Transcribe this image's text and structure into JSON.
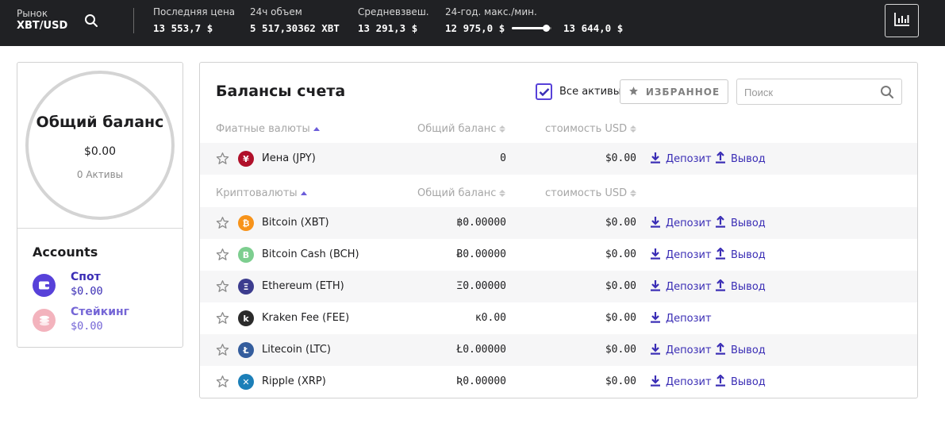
{
  "topbar": {
    "market_label": "Рынок",
    "market_pair": "XBT/USD",
    "last_price_label": "Последняя цена",
    "last_price_value": "13 553,7 $",
    "volume_label": "24ч объем",
    "volume_value": "5 517,30362 XBT",
    "vwap_label": "Средневзвеш.",
    "vwap_value": "13 291,3 $",
    "range_label": "24-год. макс./мин.",
    "range_low": "12 975,0 $",
    "range_high": "13 644,0 $",
    "range_position": 0.86
  },
  "summary": {
    "title": "Общий баланс",
    "amount": "$0.00",
    "assets_count": "0",
    "assets_label": "Активы"
  },
  "accounts": {
    "title": "Accounts",
    "items": [
      {
        "name": "Спот",
        "value": "$0.00",
        "color": "#5741d9",
        "icon": "wallet-icon"
      },
      {
        "name": "Стейкинг",
        "value": "$0.00",
        "color": "#8d7fe0",
        "icon": "coins-icon"
      }
    ]
  },
  "balances": {
    "title": "Балансы счета",
    "all_assets_label": "Все активы",
    "all_assets_checked": true,
    "favorites_label": "ИЗБРАННОЕ",
    "search_placeholder": "Поиск",
    "fiat_header": "Фиатные валюты",
    "crypto_header": "Криптовалюты",
    "balance_header": "Общий баланс",
    "usd_header": "стоимость USD",
    "deposit_label": "Депозит",
    "withdraw_label": "Вывод",
    "fiat_rows": [
      {
        "name": "Иена (JPY)",
        "symbol": "¥",
        "color": "#b0102a",
        "balance": "0",
        "usd": "$0.00",
        "withdraw": true
      }
    ],
    "crypto_rows": [
      {
        "name": "Bitcoin (XBT)",
        "symbol": "₿",
        "color": "#f7931a",
        "balance": "฿0.00000",
        "usd": "$0.00",
        "withdraw": true
      },
      {
        "name": "Bitcoin Cash (BCH)",
        "symbol": "B",
        "color": "#7dce8f",
        "balance": "Ƀ0.00000",
        "usd": "$0.00",
        "withdraw": true
      },
      {
        "name": "Ethereum (ETH)",
        "symbol": "Ξ",
        "color": "#3c3c8e",
        "balance": "Ξ0.00000",
        "usd": "$0.00",
        "withdraw": true
      },
      {
        "name": "Kraken Fee (FEE)",
        "symbol": "k",
        "color": "#2b2b2b",
        "balance": "ĸ0.00",
        "usd": "$0.00",
        "withdraw": false
      },
      {
        "name": "Litecoin (LTC)",
        "symbol": "Ł",
        "color": "#345d9d",
        "balance": "Ł0.00000",
        "usd": "$0.00",
        "withdraw": true
      },
      {
        "name": "Ripple (XRP)",
        "symbol": "✕",
        "color": "#1c7fb8",
        "balance": "Ʀ0.00000",
        "usd": "$0.00",
        "withdraw": true
      }
    ]
  }
}
